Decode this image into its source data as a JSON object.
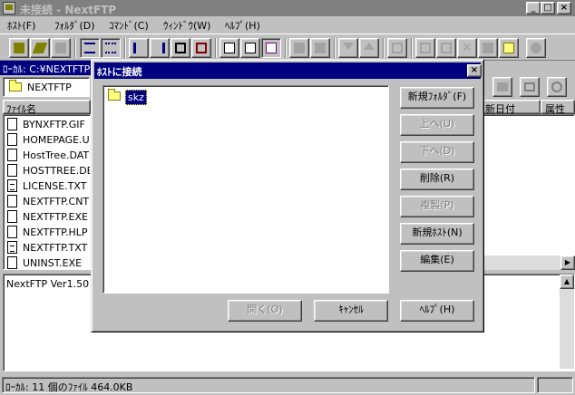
{
  "window": {
    "title": "未接続 - NextFTP",
    "min": "_",
    "max": "□",
    "close": "×"
  },
  "menu": [
    "ﾎｽﾄ(F)",
    "ﾌｫﾙﾀﾞ(D)",
    "ｺﾏﾝﾄﾞ(C)",
    "ｳｨﾝﾄﾞｳ(W)",
    "ﾍﾙﾌﾟ(H)"
  ],
  "local": {
    "path_label": "ﾛｰｶﾙ: C:¥NEXTFTP",
    "combo_value": "NEXTFTP",
    "column_header": "ﾌｧｲﾙ名",
    "files": [
      {
        "name": "BYNXFTP.GIF",
        "kind": "doc"
      },
      {
        "name": "HOMEPAGE.UI",
        "kind": "doc"
      },
      {
        "name": "HostTree.DAT",
        "kind": "doc"
      },
      {
        "name": "HOSTTREE.DE",
        "kind": "doc"
      },
      {
        "name": "LICENSE.TXT",
        "kind": "txt"
      },
      {
        "name": "NEXTFTP.CNT",
        "kind": "doc"
      },
      {
        "name": "NEXTFTP.EXE",
        "kind": "doc"
      },
      {
        "name": "NEXTFTP.HLP",
        "kind": "doc"
      },
      {
        "name": "NEXTFTP.TXT",
        "kind": "txt"
      },
      {
        "name": "UNINST.EXE",
        "kind": "doc"
      }
    ]
  },
  "remote": {
    "col_date": "新日付",
    "col_attr": "属性"
  },
  "log": {
    "text": "NextFTP Ver1.50"
  },
  "status": {
    "text": "ﾛｰｶﾙ: 11 個のﾌｧｲﾙ 464.0KB"
  },
  "dialog": {
    "title": "ﾎｽﾄに接続",
    "close": "×",
    "tree_item": "skz",
    "buttons": {
      "new_folder": "新規ﾌｫﾙﾀﾞ(F)",
      "up": "上へ(U)",
      "down": "下へ(D)",
      "delete": "削除(R)",
      "copy": "複製(P)",
      "new_host": "新規ﾎｽﾄ(N)",
      "edit": "編集(E)",
      "open": "開く(O)",
      "cancel": "ｷｬﾝｾﾙ",
      "help": "ﾍﾙﾌﾟ(H)"
    }
  },
  "colors": {
    "titlebar_active": "#000080",
    "titlebar_inactive": "#808080",
    "face": "#c0c0c0"
  },
  "toolbar_icons": [
    "connect-icon",
    "reconnect-icon",
    "disconnect-icon",
    "list-view-icon",
    "detail-view-icon",
    "sort-name-icon",
    "sort-date-icon",
    "copy-window-icon",
    "sync-icon",
    "ascii-mode-icon",
    "binary-mode-icon",
    "auto-mode-icon",
    "upload-icon",
    "download-icon",
    "move-down-icon",
    "move-up-icon",
    "properties-icon",
    "copy-icon",
    "paste-icon",
    "delete-icon",
    "rename-icon",
    "new-folder-icon",
    "stop-icon"
  ]
}
